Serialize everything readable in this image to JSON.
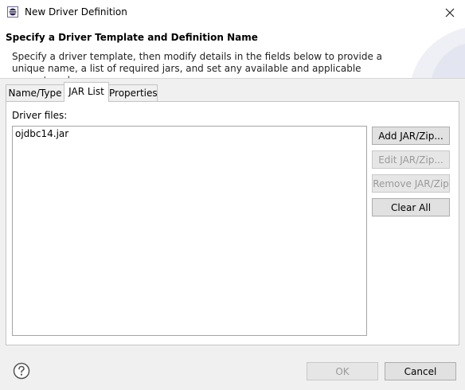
{
  "window": {
    "title": "New Driver Definition"
  },
  "banner": {
    "title": "Specify a Driver Template and Definition Name",
    "description": "Specify a driver template, then modify details in the fields below to provide a unique name, a list of required jars, and set any available and applicable property values."
  },
  "tabs": [
    {
      "label": "Name/Type",
      "active": false
    },
    {
      "label": "JAR List",
      "active": true
    },
    {
      "label": "Properties",
      "active": false
    }
  ],
  "jar_list": {
    "label": "Driver files:",
    "files": [
      "ojdbc14.jar"
    ],
    "buttons": {
      "add": "Add JAR/Zip...",
      "edit": "Edit JAR/Zip...",
      "remove": "Remove JAR/Zip",
      "clear": "Clear All"
    }
  },
  "footer": {
    "ok_label": "OK",
    "cancel_label": "Cancel"
  },
  "icons": {
    "app": "eclipse-app-icon",
    "close": "close-icon",
    "help": "help-icon"
  }
}
